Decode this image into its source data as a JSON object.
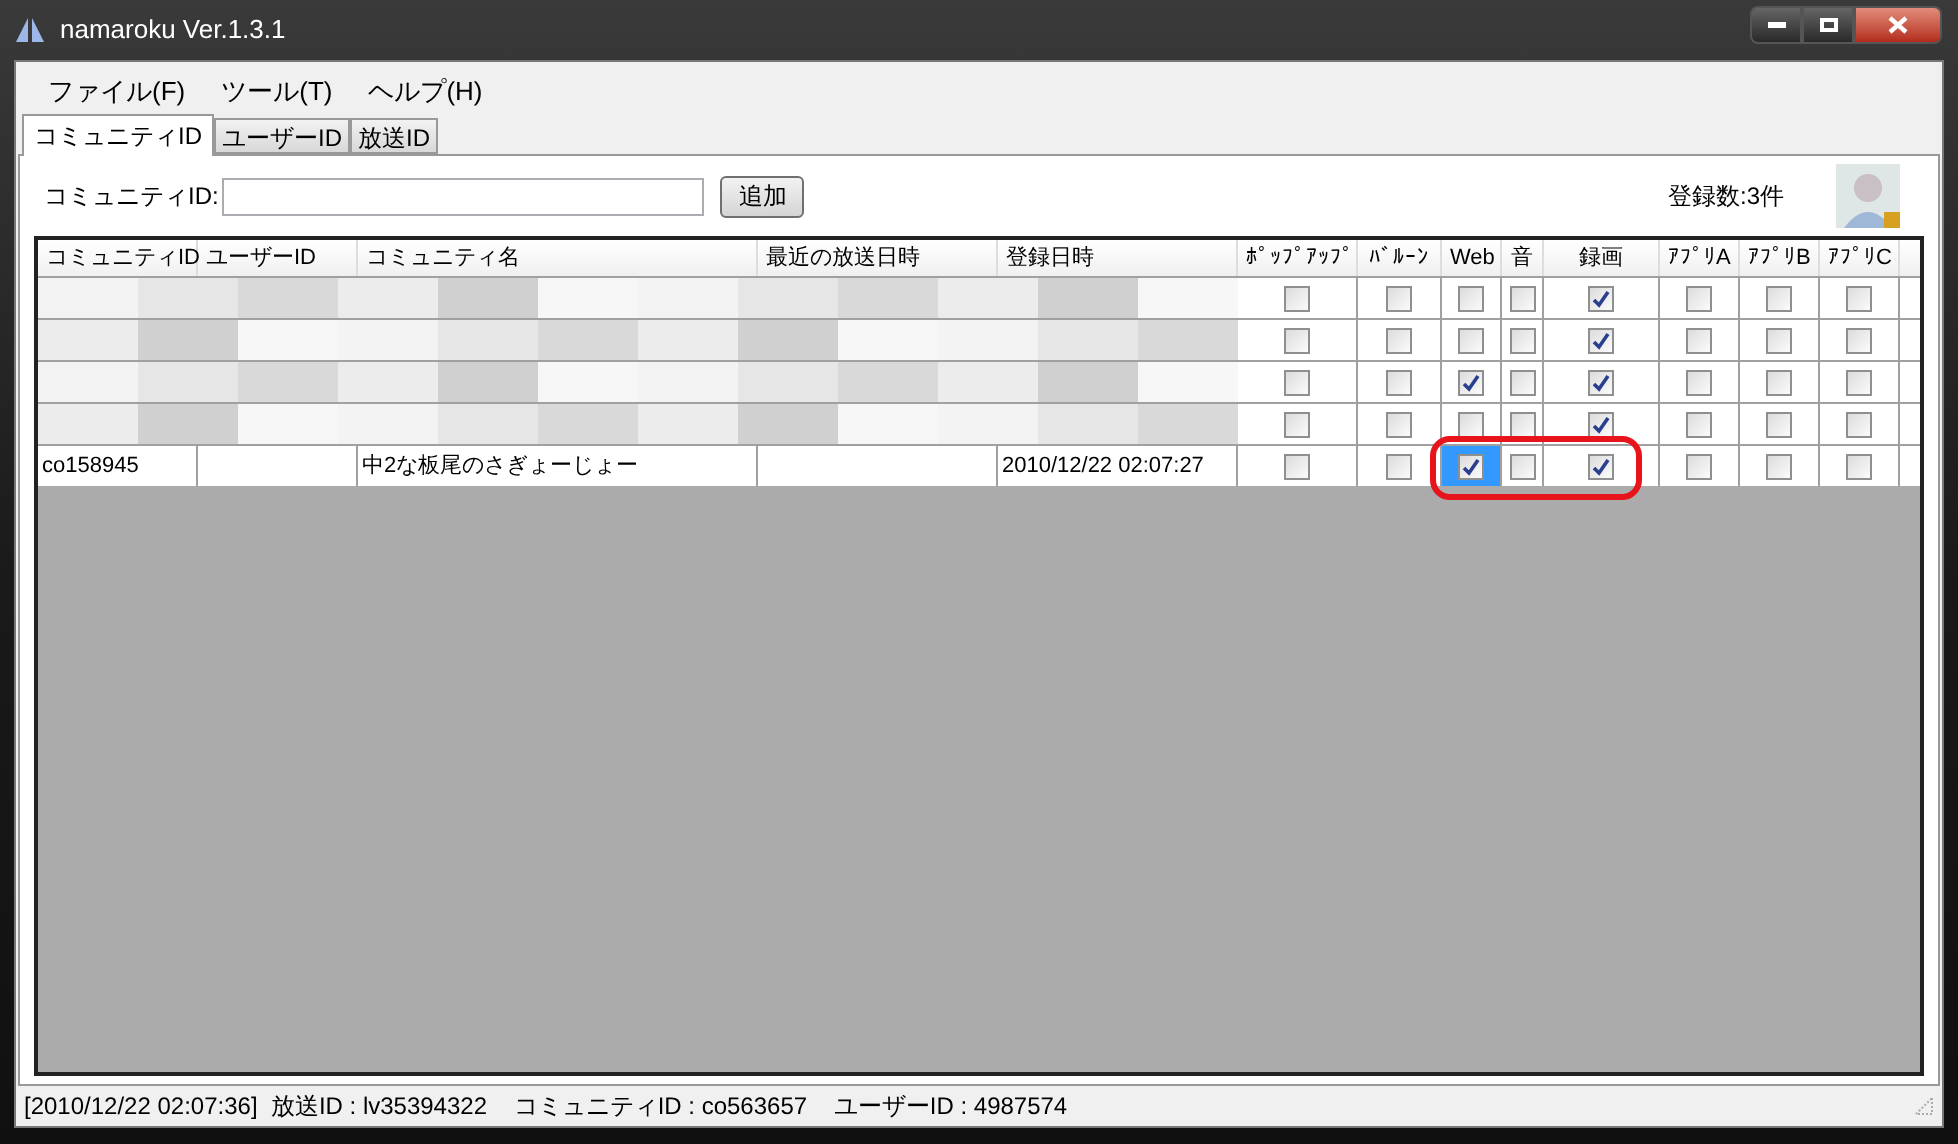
{
  "window": {
    "title": "namaroku Ver.1.3.1"
  },
  "menu": [
    "ファイル(F)",
    "ツール(T)",
    "ヘルプ(H)"
  ],
  "tabs": [
    {
      "label": "コミュニティID",
      "selected": true
    },
    {
      "label": "ユーザーID",
      "selected": false
    },
    {
      "label": "放送ID",
      "selected": false
    }
  ],
  "form": {
    "label": "コミュニティID:",
    "button": "追加",
    "count": "登録数:3件"
  },
  "table": {
    "columns": [
      "コミュニティID",
      "ユーザーID",
      "コミュニティ名",
      "最近の放送日時",
      "登録日時",
      "ﾎﾟｯﾌﾟｱｯﾌﾟ",
      "ﾊﾞﾙｰﾝ",
      "Web",
      "音",
      "録画",
      "ｱﾌﾟﾘA",
      "ｱﾌﾟﾘB",
      "ｱﾌﾟﾘC"
    ],
    "rows": [
      {
        "kind": "redacted",
        "circled": false,
        "checks": [
          {
            "checked": false,
            "selected": false
          },
          {
            "checked": false,
            "selected": false
          },
          {
            "checked": false,
            "selected": false
          },
          {
            "checked": false,
            "selected": false
          },
          {
            "checked": true,
            "selected": false
          },
          {
            "checked": false,
            "selected": false
          },
          {
            "checked": false,
            "selected": false
          },
          {
            "checked": false,
            "selected": false
          }
        ]
      },
      {
        "kind": "redacted",
        "circled": false,
        "checks": [
          {
            "checked": false,
            "selected": false
          },
          {
            "checked": false,
            "selected": false
          },
          {
            "checked": false,
            "selected": false
          },
          {
            "checked": false,
            "selected": false
          },
          {
            "checked": true,
            "selected": false
          },
          {
            "checked": false,
            "selected": false
          },
          {
            "checked": false,
            "selected": false
          },
          {
            "checked": false,
            "selected": false
          }
        ]
      },
      {
        "kind": "redacted",
        "circled": false,
        "checks": [
          {
            "checked": false,
            "selected": false
          },
          {
            "checked": false,
            "selected": false
          },
          {
            "checked": true,
            "selected": false
          },
          {
            "checked": false,
            "selected": false
          },
          {
            "checked": true,
            "selected": false
          },
          {
            "checked": false,
            "selected": false
          },
          {
            "checked": false,
            "selected": false
          },
          {
            "checked": false,
            "selected": false
          }
        ]
      },
      {
        "kind": "redacted",
        "circled": false,
        "checks": [
          {
            "checked": false,
            "selected": false
          },
          {
            "checked": false,
            "selected": false
          },
          {
            "checked": false,
            "selected": false
          },
          {
            "checked": false,
            "selected": false
          },
          {
            "checked": true,
            "selected": false
          },
          {
            "checked": false,
            "selected": false
          },
          {
            "checked": false,
            "selected": false
          },
          {
            "checked": false,
            "selected": false
          }
        ]
      },
      {
        "kind": "data",
        "cells": [
          "co158945",
          "",
          "中2な板尾のさぎょーじょー",
          "",
          "2010/12/22 02:07:27"
        ],
        "circled": true,
        "checks": [
          {
            "checked": false,
            "selected": false
          },
          {
            "checked": false,
            "selected": false
          },
          {
            "checked": true,
            "selected": true
          },
          {
            "checked": false,
            "selected": false
          },
          {
            "checked": true,
            "selected": false
          },
          {
            "checked": false,
            "selected": false
          },
          {
            "checked": false,
            "selected": false
          },
          {
            "checked": false,
            "selected": false
          }
        ]
      }
    ]
  },
  "status_bar": "[2010/12/22 02:07:36]  放送ID : lv35394322    コミュニティID : co563657    ユーザーID : 4987574"
}
